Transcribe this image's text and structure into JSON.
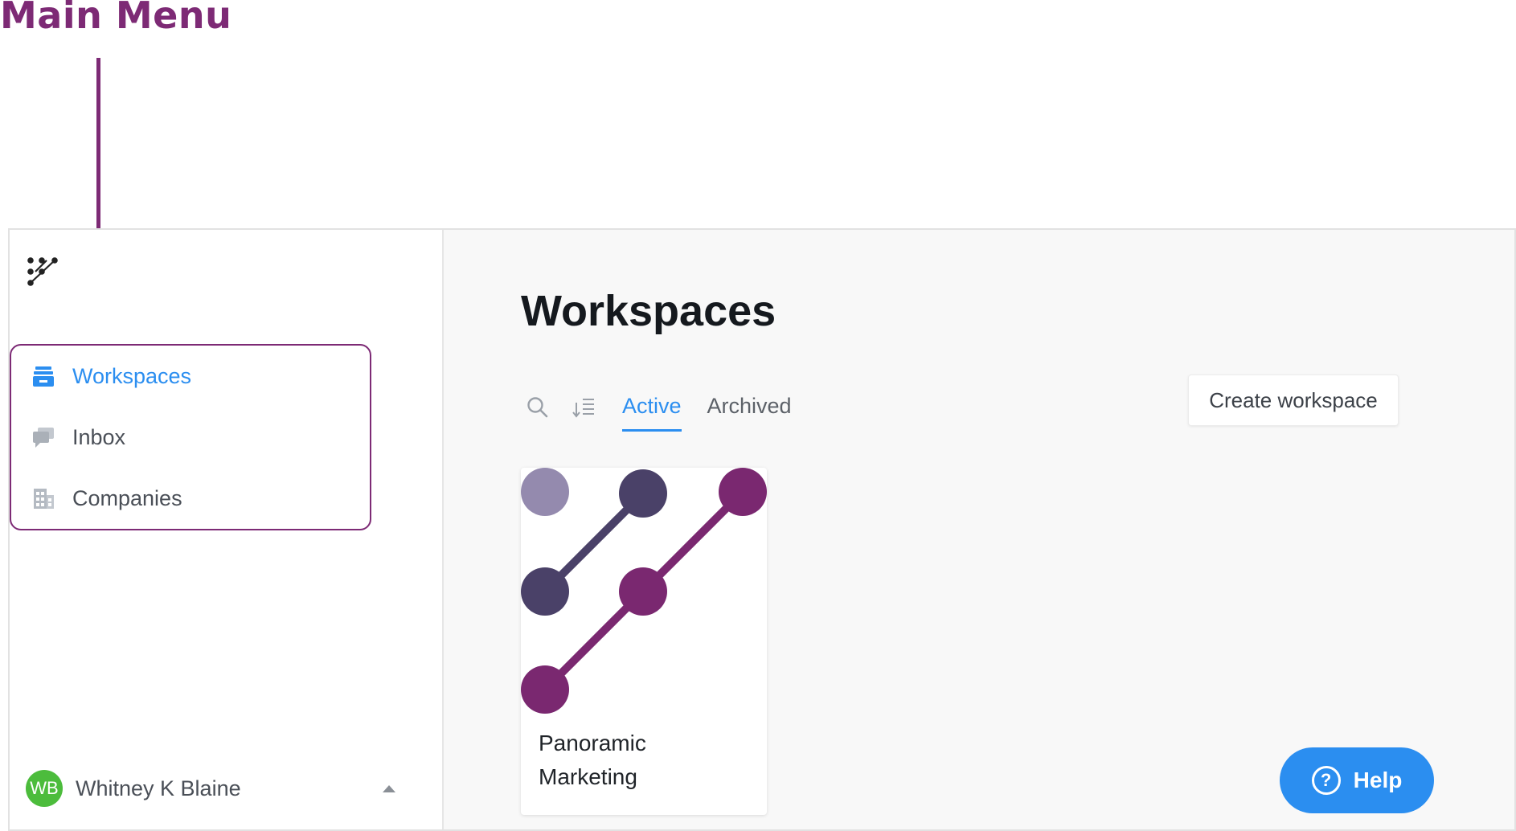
{
  "annotation": {
    "title": "Main Menu",
    "color": "#7d2a75"
  },
  "sidebar": {
    "items": [
      {
        "label": "Workspaces",
        "icon": "workspaces-icon",
        "active": true
      },
      {
        "label": "Inbox",
        "icon": "inbox-icon",
        "active": false
      },
      {
        "label": "Companies",
        "icon": "companies-icon",
        "active": false
      }
    ],
    "user": {
      "initials": "WB",
      "name": "Whitney K Blaine",
      "avatar_color": "#4cbc3c"
    }
  },
  "main": {
    "title": "Workspaces",
    "tabs": [
      {
        "label": "Active",
        "active": true
      },
      {
        "label": "Archived",
        "active": false
      }
    ],
    "create_label": "Create workspace",
    "workspaces": [
      {
        "name": "Panoramic Marketing"
      }
    ]
  },
  "help": {
    "label": "Help",
    "icon": "question-icon"
  },
  "colors": {
    "accent": "#2b8ef0",
    "brand_purple": "#7d2a75",
    "brand_dark": "#4a4168",
    "brand_light": "#948aae"
  }
}
